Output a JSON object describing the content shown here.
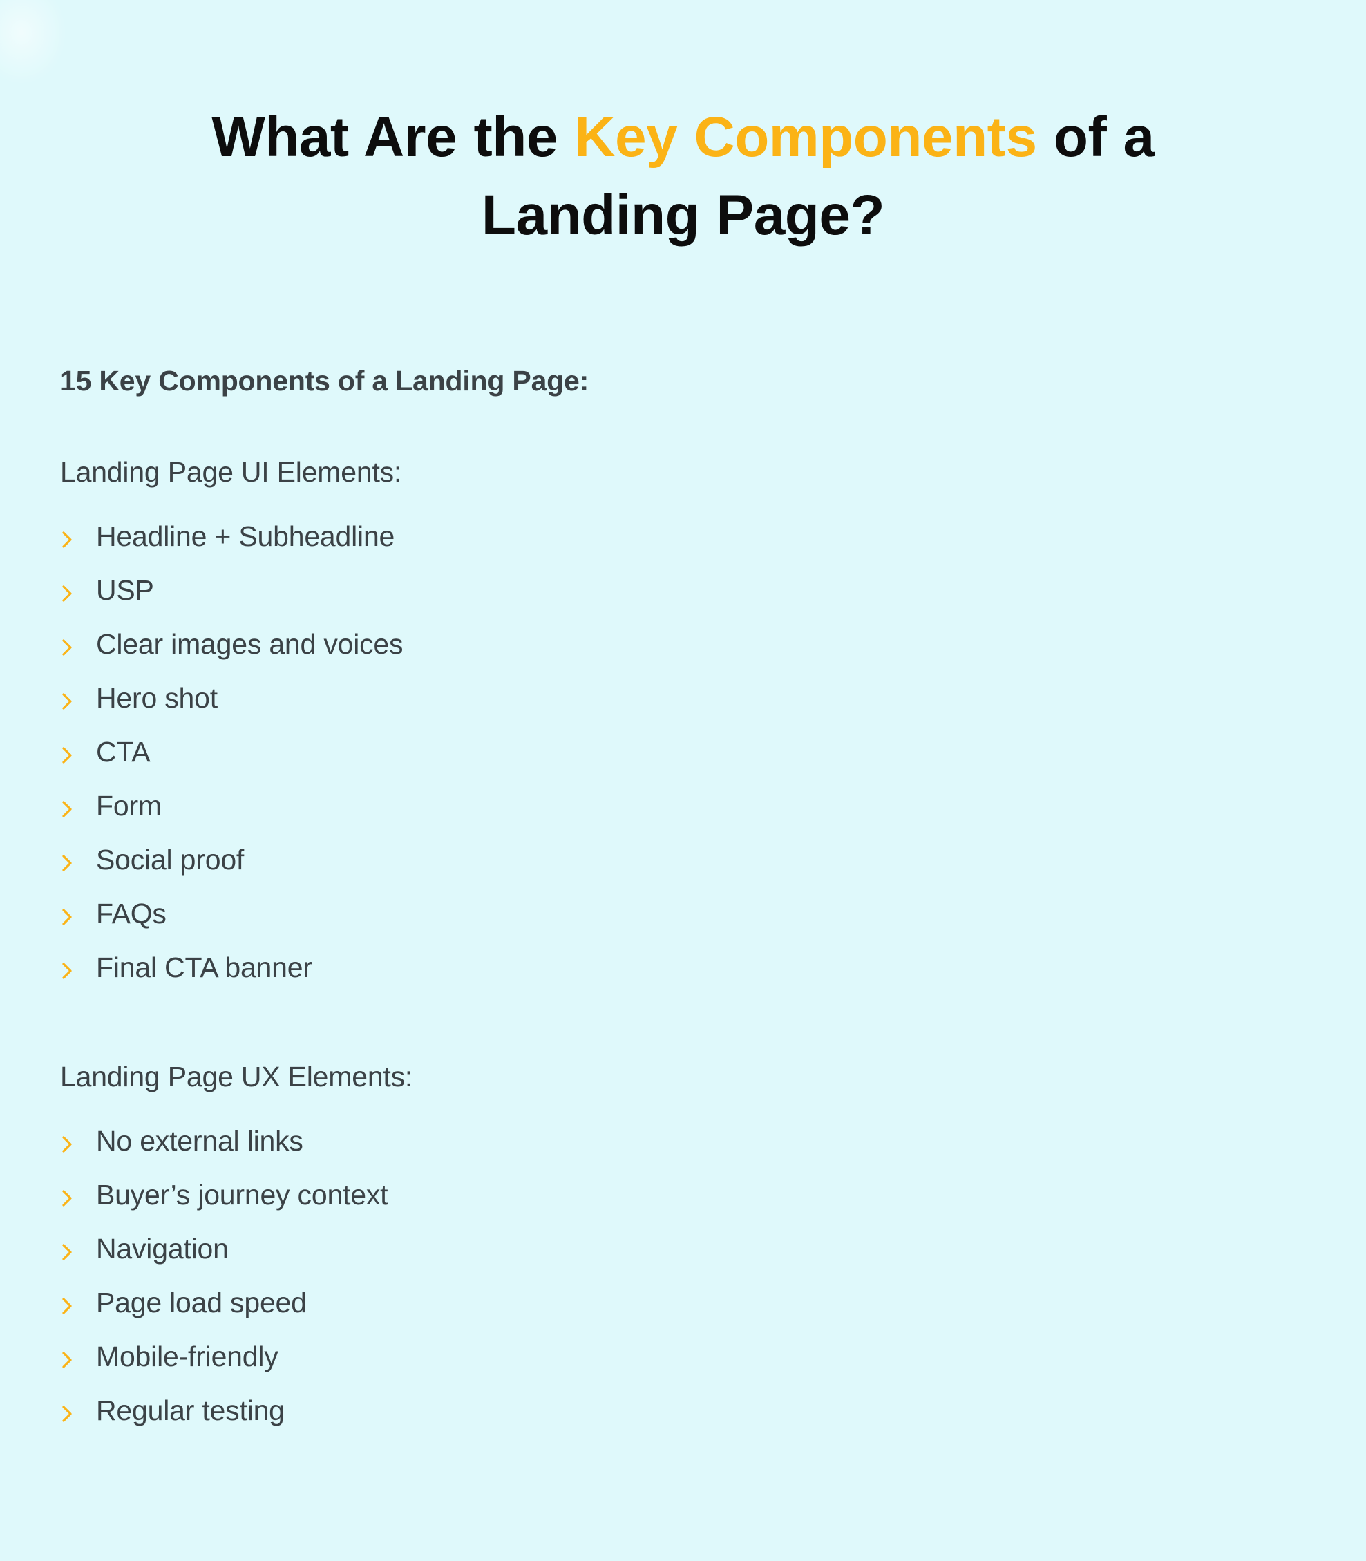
{
  "theme": {
    "background": "#dff9fb",
    "accent": "#fbb316",
    "title_color": "#0d0d0d",
    "body_text_color": "#3b4246",
    "chevron_color": "#fbb316"
  },
  "title": {
    "part1": "What Are the ",
    "accent": "Key Components",
    "part2": " of a Landing Page?",
    "full_text": "What Are the Key Components of a Landing Page?"
  },
  "body": {
    "count_heading": "15 Key Components of a Landing Page:",
    "groups": [
      {
        "heading": "Landing Page UI Elements:",
        "items": [
          "Headline + Subheadline",
          "USP",
          "Clear images and voices",
          "Hero shot",
          "CTA",
          "Form",
          "Social proof",
          "FAQs",
          "Final CTA banner"
        ]
      },
      {
        "heading": "Landing Page UX Elements:",
        "items": [
          "No external links",
          "Buyer’s journey context",
          "Navigation",
          "Page load speed",
          "Mobile-friendly",
          "Regular testing"
        ]
      }
    ]
  },
  "icons": {
    "bullet": "chevron-right-icon"
  }
}
